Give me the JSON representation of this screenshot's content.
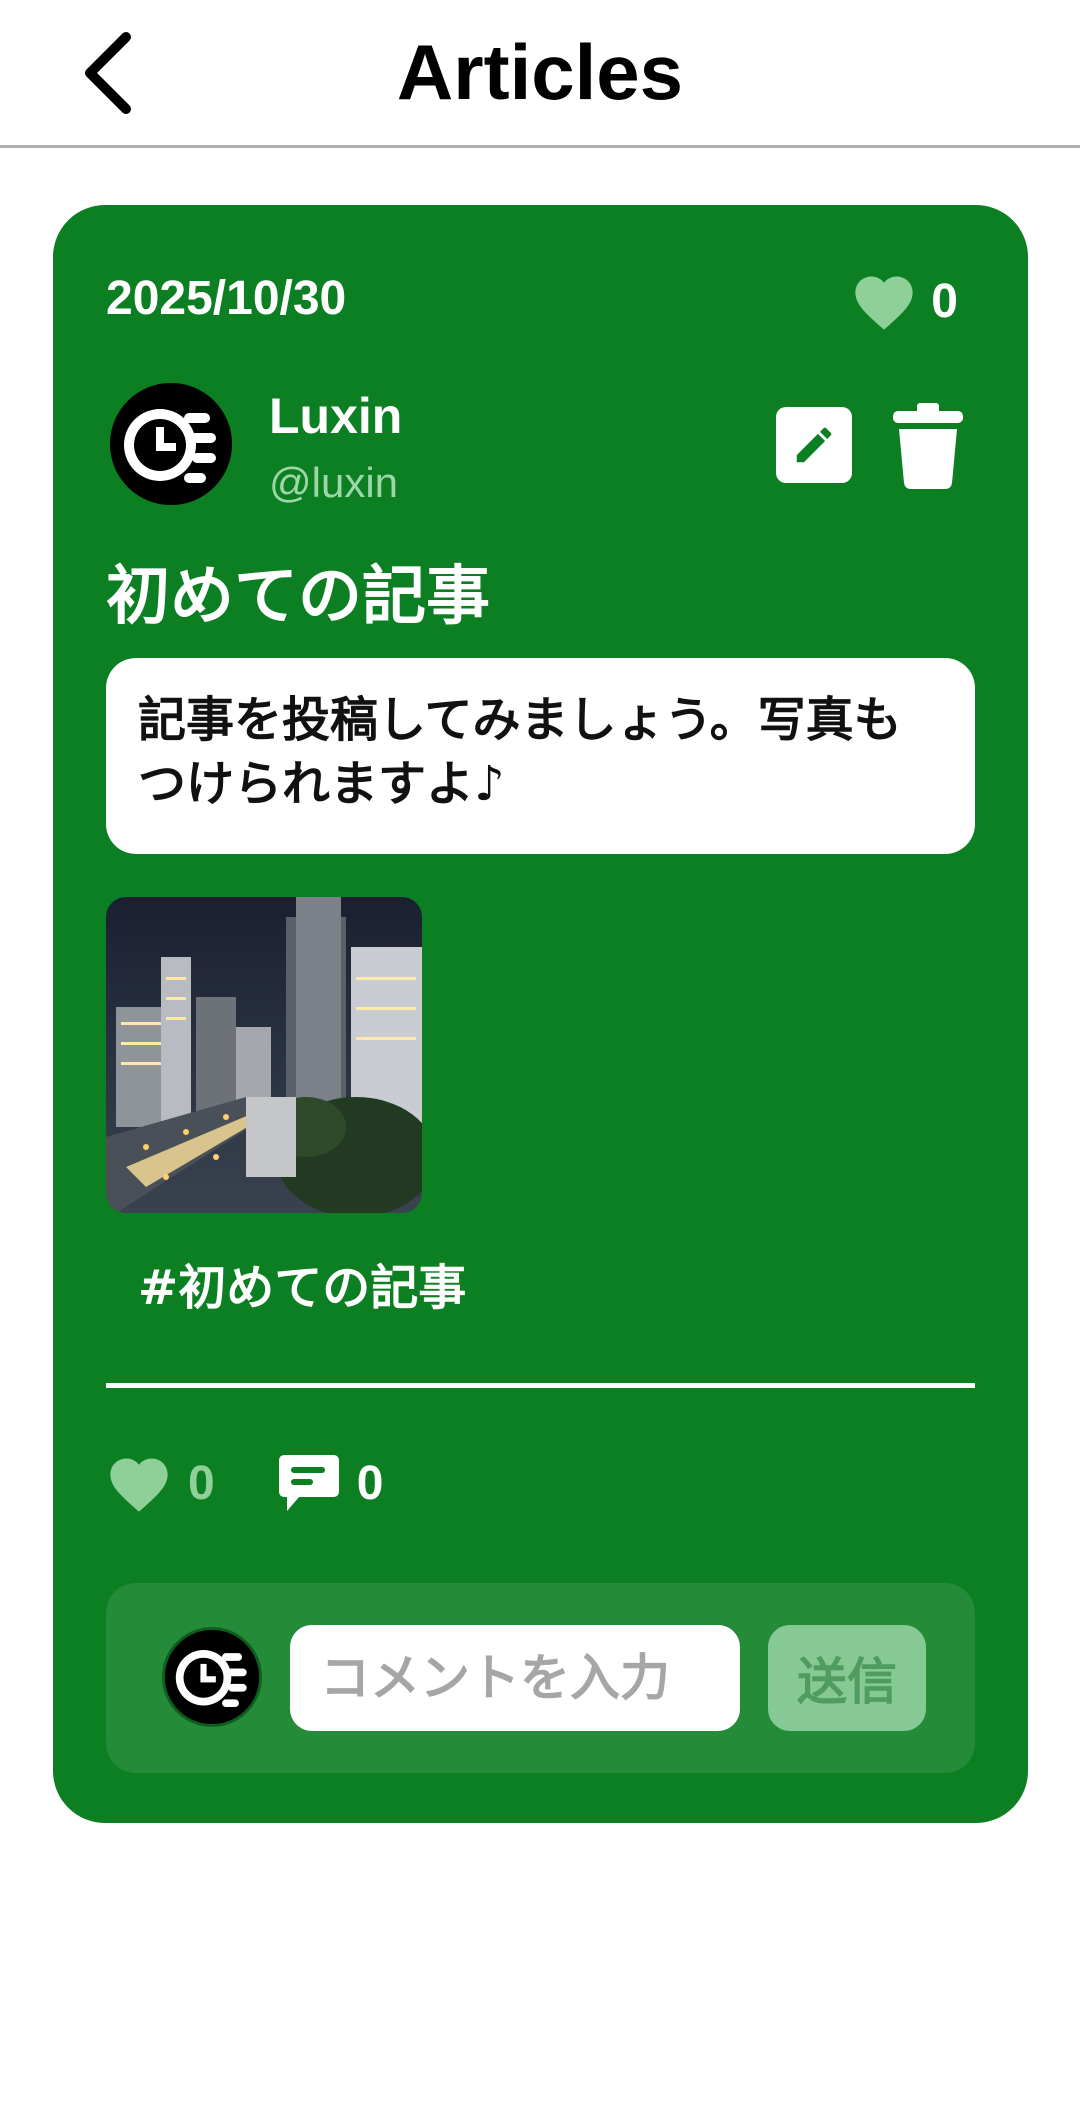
{
  "header": {
    "title": "Articles",
    "back_icon": "chevron-left-icon"
  },
  "article": {
    "date": "2025/10/30",
    "like_count_top": "0",
    "author": {
      "name": "Luxin",
      "handle": "@luxin"
    },
    "title": "初めての記事",
    "body": "記事を投稿してみましょう。写真もつけられますよ♪",
    "hashtag": "#初めての記事",
    "likes": "0",
    "comments": "0"
  },
  "comment_box": {
    "placeholder": "コメントを入力",
    "send_label": "送信"
  },
  "colors": {
    "card": "#0b7f22",
    "comment_area": "#248b38",
    "heart": "#8fcf98",
    "send_button": "#86c995"
  }
}
